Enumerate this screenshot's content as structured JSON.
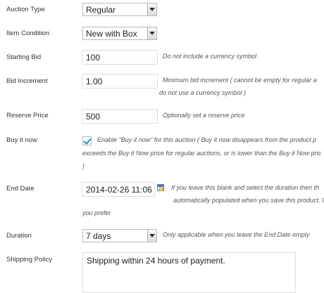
{
  "auction_type": {
    "label": "Auction Type",
    "value": "Regular"
  },
  "item_condition": {
    "label": "Item Condition",
    "value": "New with Box"
  },
  "starting_bid": {
    "label": "Starting Bid",
    "value": "100",
    "hint": "Do not include a currency symbol"
  },
  "bid_increment": {
    "label": "Bid Increment",
    "value": "1.00",
    "hint_lines": [
      "Minimum bid increment ( cannot be empty for regular a",
      "do not use a currency symbol )"
    ]
  },
  "reserve_price": {
    "label": "Reserve Price",
    "value": "500",
    "hint": "Optionally set a reserve price"
  },
  "buy_it_now": {
    "label": "Buy it now",
    "checked": true,
    "hint_lines": [
      "Enable \"Buy it now\" for this auction ( Buy it now disappears from the product p",
      "exceeds the Buy it Now price for regular auctions, or is lower than the Buy it Now pric",
      ")"
    ]
  },
  "end_date": {
    "label": "End Date",
    "value": "2014-02-26 11:06",
    "hint_lines": [
      "If you leave this blank and select the duration then th",
      "automatically populated when you save this product. Or m",
      "you prefer"
    ]
  },
  "duration": {
    "label": "Duration",
    "value": "7 days",
    "hint": "Only applicable when you leave the End Date empty"
  },
  "shipping_policy": {
    "label": "Shipping Policy",
    "value": "Shipping within 24 hours of payment."
  }
}
